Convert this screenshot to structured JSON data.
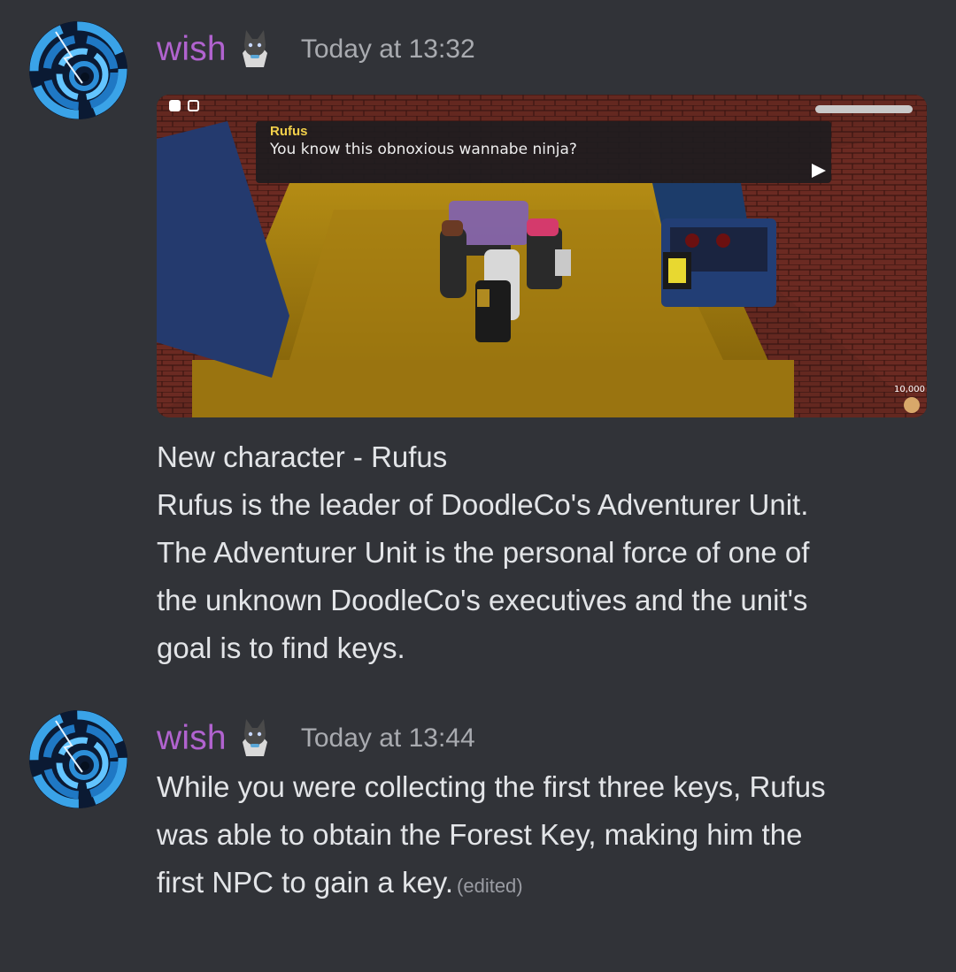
{
  "messages": [
    {
      "author": "wish",
      "timestamp": "Today at 13:32",
      "embed": {
        "speaker": "Rufus",
        "dialog_text": "You know this obnoxious wannabe ninja?",
        "currency": "10,000"
      },
      "lines": [
        "New character - Rufus",
        "Rufus is the leader of DoodleCo's Adventurer Unit.",
        "The Adventurer Unit is the personal force of one of",
        "the unknown DoodleCo's executives and the unit's",
        "goal is to find keys."
      ]
    },
    {
      "author": "wish",
      "timestamp": "Today at 13:44",
      "lines": [
        "While you were collecting the first three keys, Rufus",
        "was able to obtain the Forest Key, making him the",
        "first NPC to gain a key."
      ],
      "edited_label": "(edited)"
    }
  ],
  "colors": {
    "background": "#313338",
    "username": "#b163cf",
    "timestamp": "#a9abb0",
    "text": "#e3e5e8"
  },
  "icons": {
    "avatar": "blue-vortex-avatar-icon",
    "badge": "cat-badge-icon"
  }
}
